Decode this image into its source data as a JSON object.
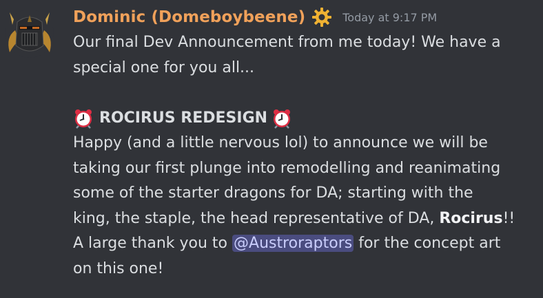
{
  "message": {
    "username": "Dominic (Domeboybeene)",
    "timestamp": "Today at 9:17 PM",
    "intro_lines": [
      "Our final Dev Announcement from me today! We have a",
      "special one for you all..."
    ],
    "heading_emoji": "alarm-clock",
    "heading": "ROCIRUS REDESIGN",
    "body_lines": [
      "Happy (and a little nervous lol) to announce we will be",
      "taking our first plunge into remodelling and reanimating",
      "some of the starter dragons for DA; starting with the"
    ],
    "line_king_prefix": "king, the staple, the head representative of DA, ",
    "line_king_bold": "Rocirus",
    "line_king_suffix": "!!",
    "line_thanks_prefix": "A large thank you to ",
    "mention": "@Austroraptors",
    "line_thanks_suffix": " for the concept art",
    "last_line": "on this one!"
  },
  "colors": {
    "background": "#313338",
    "username": "#f0a15a",
    "timestamp": "#949ba4",
    "text": "#dbdee1",
    "mention_bg": "#4a4c7f",
    "mention_text": "#c9cdfb",
    "role_icon": "#f0b232"
  }
}
